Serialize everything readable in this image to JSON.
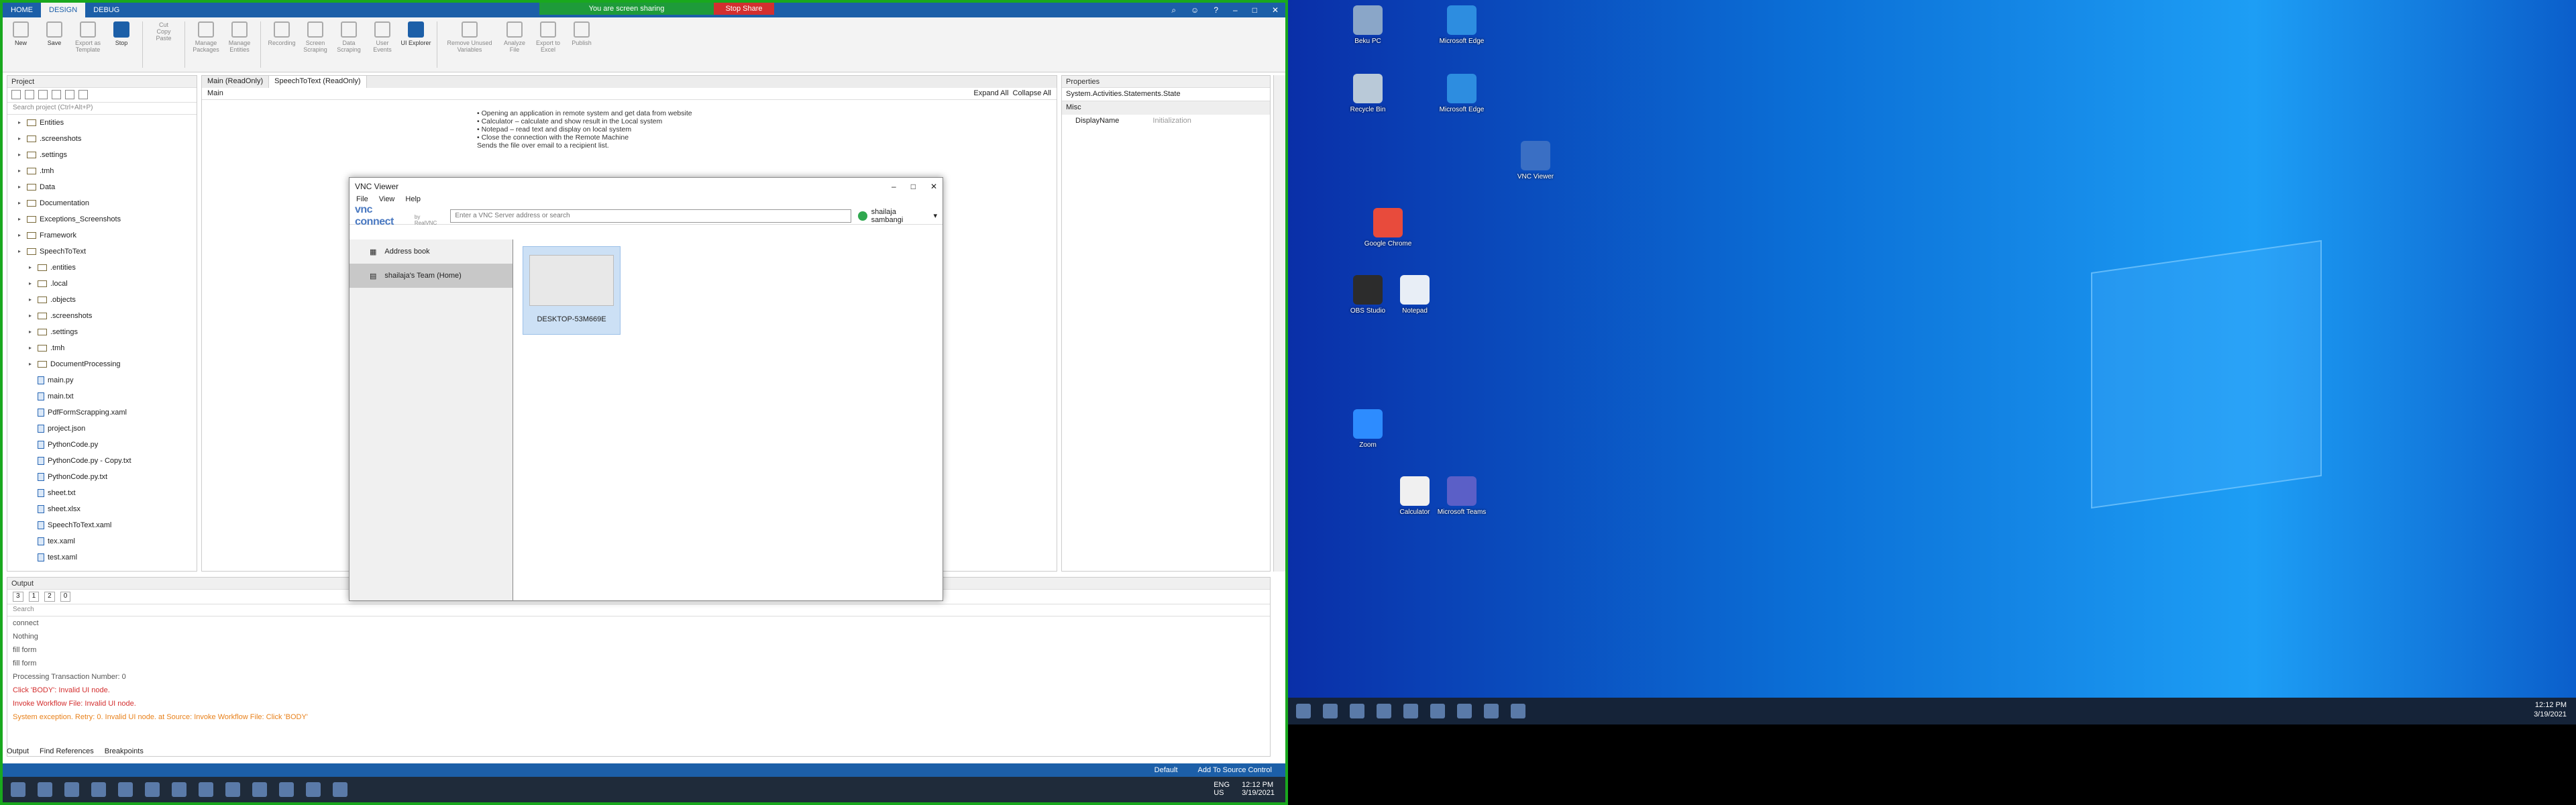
{
  "share": {
    "status": "You are screen sharing",
    "stop": "Stop Share"
  },
  "ribbon": {
    "tabs": [
      "HOME",
      "DESIGN",
      "DEBUG"
    ],
    "buttons": [
      {
        "label": "New"
      },
      {
        "label": "Save"
      },
      {
        "label": "Export as Template"
      },
      {
        "label": "Stop"
      },
      {
        "label": "Cut"
      },
      {
        "label": "Copy"
      },
      {
        "label": "Paste"
      },
      {
        "label": "Manage Packages"
      },
      {
        "label": "Manage Entities"
      },
      {
        "label": "Recording"
      },
      {
        "label": "Screen Scraping"
      },
      {
        "label": "Data Scraping"
      },
      {
        "label": "User Events"
      },
      {
        "label": "UI Explorer"
      },
      {
        "label": "Remove Unused Variables"
      },
      {
        "label": "Analyze File"
      },
      {
        "label": "Export to Excel"
      },
      {
        "label": "Publish"
      }
    ]
  },
  "project": {
    "title": "Project",
    "search_placeholder": "Search project (Ctrl+Alt+P)",
    "tree": [
      {
        "label": "Entities",
        "type": "folder",
        "depth": 1
      },
      {
        "label": ".screenshots",
        "type": "folder",
        "depth": 1
      },
      {
        "label": ".settings",
        "type": "folder",
        "depth": 1
      },
      {
        "label": ".tmh",
        "type": "folder",
        "depth": 1
      },
      {
        "label": "Data",
        "type": "folder",
        "depth": 1
      },
      {
        "label": "Documentation",
        "type": "folder",
        "depth": 1
      },
      {
        "label": "Exceptions_Screenshots",
        "type": "folder",
        "depth": 1
      },
      {
        "label": "Framework",
        "type": "folder",
        "depth": 1
      },
      {
        "label": "SpeechToText",
        "type": "folder",
        "depth": 1
      },
      {
        "label": ".entities",
        "type": "folder",
        "depth": 2
      },
      {
        "label": ".local",
        "type": "folder",
        "depth": 2
      },
      {
        "label": ".objects",
        "type": "folder",
        "depth": 2
      },
      {
        "label": ".screenshots",
        "type": "folder",
        "depth": 2
      },
      {
        "label": ".settings",
        "type": "folder",
        "depth": 2
      },
      {
        "label": ".tmh",
        "type": "folder",
        "depth": 2
      },
      {
        "label": "DocumentProcessing",
        "type": "folder",
        "depth": 2
      },
      {
        "label": "main.py",
        "type": "file",
        "depth": 2
      },
      {
        "label": "main.txt",
        "type": "file",
        "depth": 2
      },
      {
        "label": "PdfFormScrapping.xaml",
        "type": "file",
        "depth": 2
      },
      {
        "label": "project.json",
        "type": "file",
        "depth": 2
      },
      {
        "label": "PythonCode.py",
        "type": "file",
        "depth": 2
      },
      {
        "label": "PythonCode.py - Copy.txt",
        "type": "file",
        "depth": 2
      },
      {
        "label": "PythonCode.py.txt",
        "type": "file",
        "depth": 2
      },
      {
        "label": "sheet.txt",
        "type": "file",
        "depth": 2
      },
      {
        "label": "sheet.xlsx",
        "type": "file",
        "depth": 2
      },
      {
        "label": "SpeechToText.xaml",
        "type": "file",
        "depth": 2
      },
      {
        "label": "tex.xaml",
        "type": "file",
        "depth": 2
      },
      {
        "label": "test.xaml",
        "type": "file",
        "depth": 2
      }
    ]
  },
  "designer": {
    "tabs": [
      "Main (ReadOnly)",
      "SpeechToText (ReadOnly)"
    ],
    "main_label": "Main",
    "expand_all": "Expand All",
    "collapse_all": "Collapse All",
    "lines": [
      "• Opening an application in remote system and get data from website",
      "• Calculator – calculate and show result in the Local system",
      "• Notepad – read text and display on local system",
      "• Close the connection with the Remote Machine",
      "Sends the file over email to a recipient list."
    ]
  },
  "properties": {
    "title": "Properties",
    "subtitle": "System.Activities.Statements.State",
    "group": "Misc",
    "row_name": "DisplayName",
    "row_value": "Initialization"
  },
  "output": {
    "title": "Output",
    "search_placeholder": "Search",
    "badges": [
      "3",
      "1",
      "2",
      "0"
    ],
    "lines": [
      {
        "text": "connect",
        "kind": "info"
      },
      {
        "text": "Nothing",
        "kind": "info"
      },
      {
        "text": "fill form",
        "kind": "info"
      },
      {
        "text": "fill form",
        "kind": "info"
      },
      {
        "text": "Processing Transaction Number: 0",
        "kind": "info"
      },
      {
        "text": "Click 'BODY': Invalid UI node.",
        "kind": "err"
      },
      {
        "text": "Invoke Workflow File: Invalid UI node.",
        "kind": "err"
      },
      {
        "text": "System exception. Retry: 0. Invalid UI node. at Source: Invoke Workflow File: Click 'BODY'",
        "kind": "orange"
      }
    ],
    "tabs": [
      "Output",
      "Find References",
      "Breakpoints"
    ]
  },
  "status": {
    "default": "Default",
    "source_control": "Add To Source Control"
  },
  "vnc": {
    "title": "VNC Viewer",
    "menu": [
      "File",
      "View",
      "Help"
    ],
    "logo": "vnc connect",
    "logo_sub": "by RealVNC",
    "address_placeholder": "Enter a VNC Server address or search",
    "user": "shailaja sambangi",
    "sidebar": [
      "Address book",
      "shailaja's Team (Home)"
    ],
    "machine": "DESKTOP-53M669E"
  },
  "taskbar_left": {
    "time": "12:12 PM",
    "date": "3/19/2021",
    "lang": "ENG",
    "region": "US"
  },
  "desktop": {
    "icons": [
      "Beku PC",
      "Recycle Bin",
      "Microsoft Edge",
      "Microsoft Edge",
      "VNC Viewer",
      "Google Chrome",
      "OBS Studio",
      "Notepad",
      "Zoom",
      "Calculator",
      "Microsoft Teams"
    ],
    "clock_time": "12:12 PM",
    "clock_date": "3/19/2021"
  }
}
